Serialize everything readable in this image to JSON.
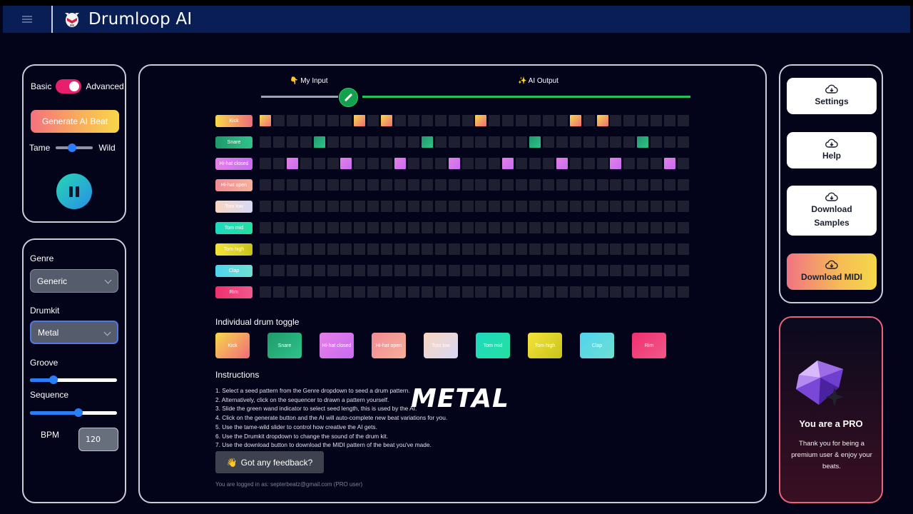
{
  "app": {
    "title": "Drumloop AI"
  },
  "left_top": {
    "mode_left": "Basic",
    "mode_right": "Advanced",
    "generate_label": "Generate AI Beat",
    "tame_label": "Tame",
    "wild_label": "Wild",
    "tame_wild_value": 0.45
  },
  "left_bottom": {
    "genre_label": "Genre",
    "genre_value": "Generic",
    "drumkit_label": "Drumkit",
    "drumkit_value": "Metal",
    "groove_label": "Groove",
    "groove_value": 0.27,
    "sequence_label": "Sequence",
    "sequence_value": 0.56,
    "bpm_label": "BPM",
    "bpm_value": "120"
  },
  "sequencer": {
    "input_label": "👇 My Input",
    "output_label": "✨ AI Output",
    "steps": 32,
    "rows": [
      {
        "label": "Kick",
        "color_a": "#f7d94a",
        "color_b": "#f06c7a",
        "active": [
          0,
          7,
          9,
          16,
          23,
          25
        ]
      },
      {
        "label": "Snare",
        "color_a": "#1f9a6a",
        "color_b": "#2fc38c",
        "active": [
          4,
          12,
          20,
          28
        ]
      },
      {
        "label": "Hi-hat closed",
        "color_a": "#e57ee9",
        "color_b": "#c86df0",
        "active": [
          2,
          6,
          10,
          14,
          18,
          22,
          26,
          30
        ]
      },
      {
        "label": "Hi-hat open",
        "color_a": "#f28a93",
        "color_b": "#f6b09a",
        "active": []
      },
      {
        "label": "Tom low",
        "color_a": "#f9d6c0",
        "color_b": "#d8d8f5",
        "active": []
      },
      {
        "label": "Tom mid",
        "color_a": "#20d8c0",
        "color_b": "#24e0a0",
        "active": []
      },
      {
        "label": "Tom high",
        "color_a": "#f5e43a",
        "color_b": "#c8c41c",
        "active": []
      },
      {
        "label": "Clap",
        "color_a": "#4fd3f0",
        "color_b": "#6ee0d0",
        "active": []
      },
      {
        "label": "Rim",
        "color_a": "#f0306e",
        "color_b": "#f0588a",
        "active": []
      }
    ]
  },
  "toggles": {
    "title": "Individual drum toggle",
    "items": [
      "Kick",
      "Snare",
      "Hi-hat closed",
      "Hi-hat open",
      "Tom low",
      "Tom mid",
      "Tom high",
      "Clap",
      "Rim"
    ]
  },
  "instructions": {
    "title": "Instructions",
    "items": [
      "1. Select a seed pattern from the Genre dropdown to seed a drum pattern.",
      "2. Alternatively, click on the sequencer to drawn a pattern yourself.",
      "3. Slide the green wand indicator to select seed length, this is used by the AI.",
      "4. Click on the generate button and the AI will auto-complete new beat variations for you.",
      "5. Use the tame-wild slider to control how creative the AI gets.",
      "6. Use the Drumkit dropdown to change the sound of the drum kit.",
      "7. Use the download button to download the MIDI pattern of the beat you've made."
    ]
  },
  "overlay_word": "METAL",
  "feedback": {
    "icon": "👋",
    "label": "Got any feedback?"
  },
  "logged_in": "You are logged in as: septerbeatz@gmail.com (PRO user)",
  "right": {
    "settings_label": "Settings",
    "help_label": "Help",
    "download_samples_line1": "Download",
    "download_samples_line2": "Samples",
    "download_midi_label": "Download MIDI"
  },
  "pro": {
    "title": "You are a PRO",
    "text": "Thank you for being a premium user & enjoy your beats."
  }
}
